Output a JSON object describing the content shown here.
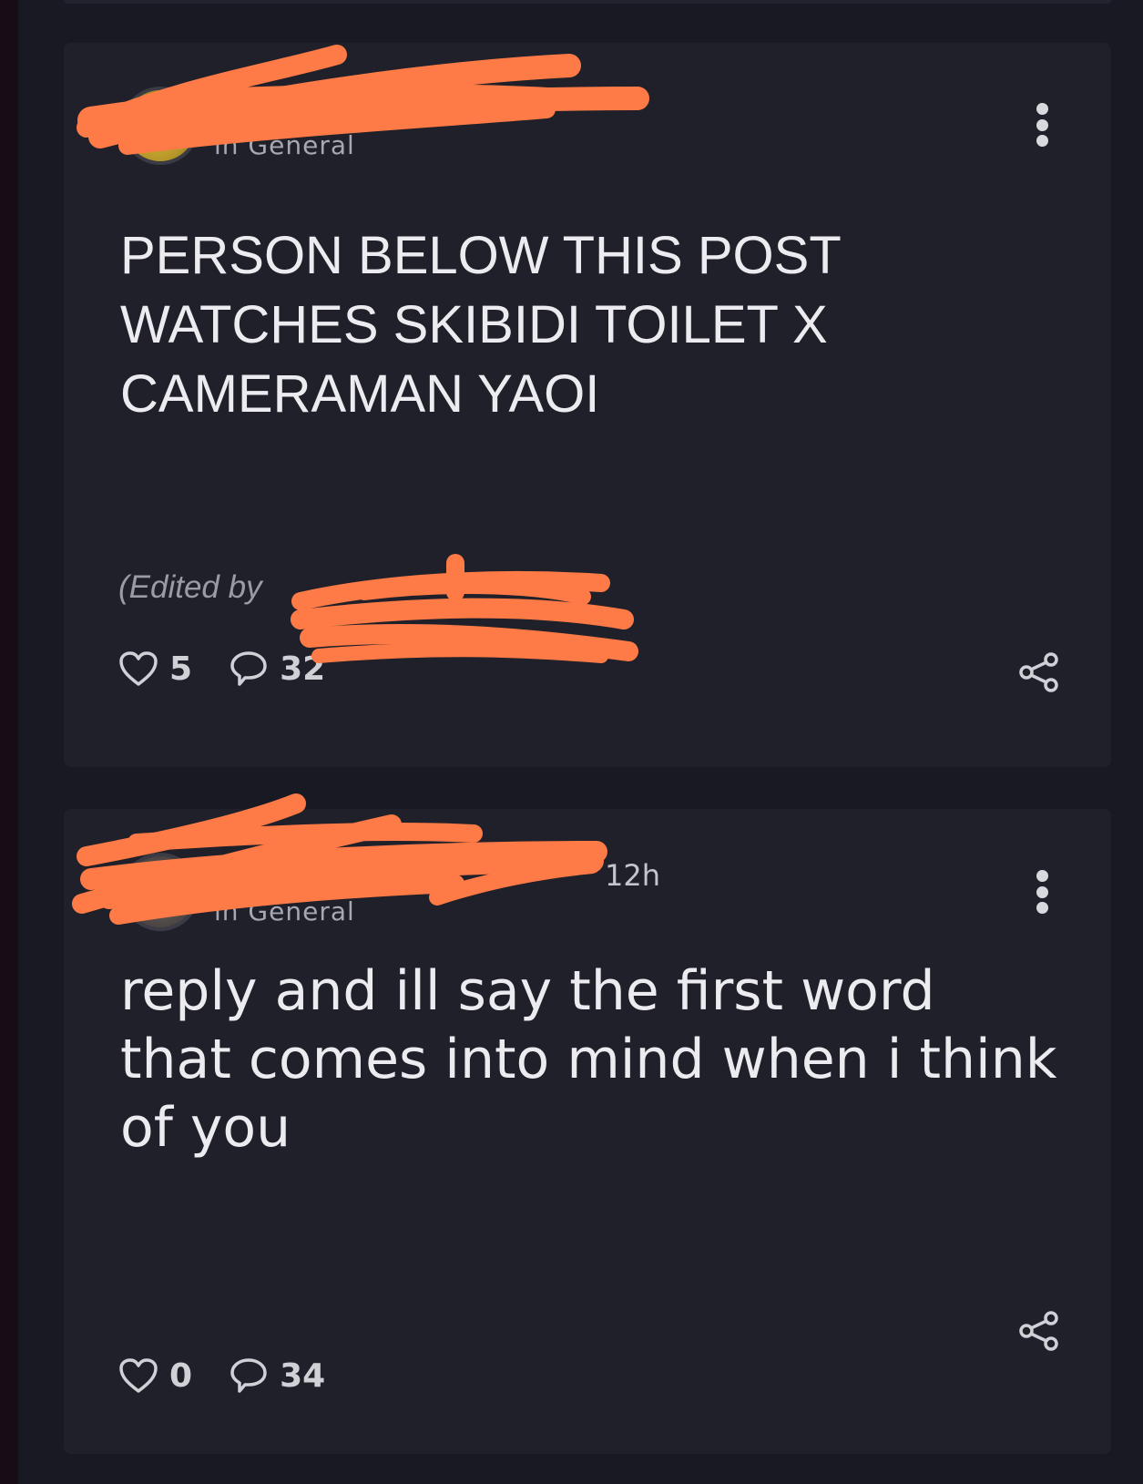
{
  "posts": [
    {
      "author": "",
      "timestamp": "",
      "community": "in General",
      "body": "PERSON BELOW THIS POST WATCHES SKIBIDI TOILET X CAMERAMAN YAOI",
      "edited_note": "(Edited by",
      "likes": "5",
      "comments": "32"
    },
    {
      "author": "",
      "timestamp": "12h",
      "community": "in General",
      "body": "reply and ill say the first word that comes into mind when i think of you",
      "likes": "0",
      "comments": "34"
    }
  ],
  "colors": {
    "background": "#181922",
    "card": "#1f2029",
    "text": "#ececf0",
    "muted": "#a7a8b2",
    "redaction": "#fe7a46"
  },
  "icons": {
    "menu": "vertical-ellipsis-icon",
    "like": "heart-outline-icon",
    "comment": "speech-bubble-icon",
    "share": "share-nodes-icon"
  }
}
